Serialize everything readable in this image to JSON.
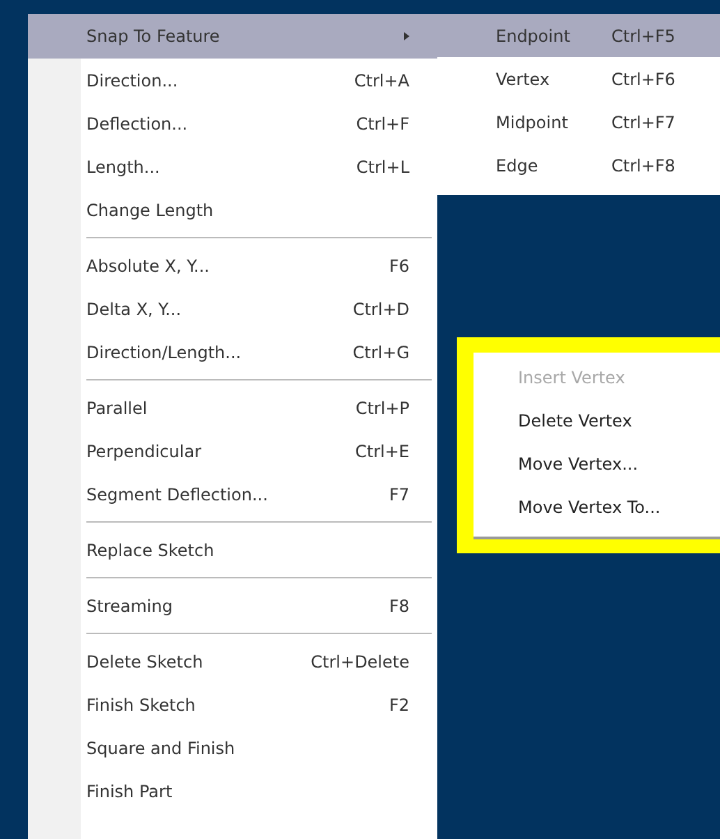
{
  "main_menu": {
    "items": [
      {
        "kind": "item",
        "label": "Snap To Feature",
        "has_submenu": true,
        "selected": true
      },
      {
        "kind": "item",
        "label": "Direction...",
        "shortcut": "Ctrl+A",
        "has_submenu": false,
        "selected": false
      },
      {
        "kind": "item",
        "label": "Deflection...",
        "shortcut": "Ctrl+F",
        "has_submenu": false,
        "selected": false
      },
      {
        "kind": "item",
        "label": "Length...",
        "shortcut": "Ctrl+L",
        "has_submenu": false,
        "selected": false
      },
      {
        "kind": "item",
        "label": "Change Length",
        "has_submenu": false,
        "selected": false
      },
      {
        "kind": "separator"
      },
      {
        "kind": "item",
        "label": "Absolute X, Y...",
        "shortcut": "F6",
        "has_submenu": false,
        "selected": false
      },
      {
        "kind": "item",
        "label": "Delta X, Y...",
        "shortcut": "Ctrl+D",
        "has_submenu": false,
        "selected": false
      },
      {
        "kind": "item",
        "label": "Direction/Length...",
        "shortcut": "Ctrl+G",
        "has_submenu": false,
        "selected": false
      },
      {
        "kind": "separator"
      },
      {
        "kind": "item",
        "label": "Parallel",
        "shortcut": "Ctrl+P",
        "has_submenu": false,
        "selected": false
      },
      {
        "kind": "item",
        "label": "Perpendicular",
        "shortcut": "Ctrl+E",
        "has_submenu": false,
        "selected": false
      },
      {
        "kind": "item",
        "label": "Segment Deflection...",
        "shortcut": "F7",
        "has_submenu": false,
        "selected": false
      },
      {
        "kind": "separator"
      },
      {
        "kind": "item",
        "label": "Replace Sketch",
        "has_submenu": false,
        "selected": false
      },
      {
        "kind": "separator"
      },
      {
        "kind": "item",
        "label": "Streaming",
        "shortcut": "F8",
        "has_submenu": false,
        "selected": false
      },
      {
        "kind": "separator"
      },
      {
        "kind": "item",
        "label": "Delete Sketch",
        "shortcut": "Ctrl+Delete",
        "has_submenu": false,
        "selected": false
      },
      {
        "kind": "item",
        "label": "Finish Sketch",
        "shortcut": "F2",
        "has_submenu": false,
        "selected": false
      },
      {
        "kind": "item",
        "label": "Square and Finish",
        "has_submenu": false,
        "selected": false
      },
      {
        "kind": "item",
        "label": "Finish Part",
        "has_submenu": false,
        "selected": false
      }
    ]
  },
  "submenu": {
    "items": [
      {
        "label": "Endpoint",
        "shortcut": "Ctrl+F5",
        "selected": true
      },
      {
        "label": "Vertex",
        "shortcut": "Ctrl+F6",
        "selected": false
      },
      {
        "label": "Midpoint",
        "shortcut": "Ctrl+F7",
        "selected": false
      },
      {
        "label": "Edge",
        "shortcut": "Ctrl+F8",
        "selected": false
      }
    ]
  },
  "context_menu": {
    "highlighted": true,
    "items": [
      {
        "label": "Insert Vertex",
        "disabled": true
      },
      {
        "label": "Delete Vertex",
        "disabled": false
      },
      {
        "label": "Move Vertex...",
        "disabled": false
      },
      {
        "label": "Move Vertex To...",
        "disabled": false
      }
    ]
  }
}
